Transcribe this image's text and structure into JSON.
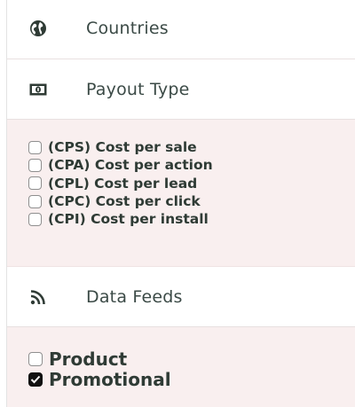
{
  "sections": {
    "countries": {
      "icon": "globe-icon",
      "label": "Countries"
    },
    "payout_type": {
      "icon": "money-bill-icon",
      "label": "Payout Type",
      "options": [
        {
          "label": "(CPS) Cost per sale",
          "checked": false
        },
        {
          "label": "(CPA) Cost per action",
          "checked": false
        },
        {
          "label": "(CPL) Cost per lead",
          "checked": false
        },
        {
          "label": "(CPC) Cost per click",
          "checked": false
        },
        {
          "label": "(CPI) Cost per install",
          "checked": false
        }
      ]
    },
    "data_feeds": {
      "icon": "rss-icon",
      "label": "Data Feeds",
      "options": [
        {
          "label": "Product",
          "checked": false
        },
        {
          "label": "Promotional",
          "checked": true
        }
      ]
    }
  },
  "colors": {
    "panel_bg": "#f9efef",
    "text": "#2f3b35",
    "header_text": "#3b4a46"
  }
}
